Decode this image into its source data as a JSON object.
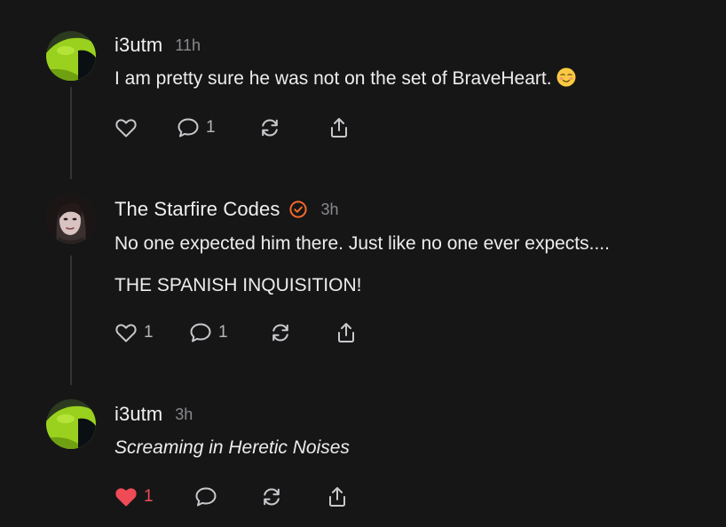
{
  "posts": [
    {
      "username": "i3utm",
      "time": "11h",
      "lines": [
        "I am pretty sure he was not on the set of BraveHeart."
      ],
      "emoji": "relieved-face",
      "likes": "",
      "replies": "1",
      "liked": false
    },
    {
      "username": "The Starfire Codes",
      "time": "3h",
      "verified": true,
      "lines": [
        "No one expected him there. Just like no one ever expects....",
        "THE SPANISH INQUISITION!"
      ],
      "likes": "1",
      "replies": "1",
      "liked": false
    },
    {
      "username": "i3utm",
      "time": "3h",
      "lines": [
        "Screaming in Heretic Noises"
      ],
      "italic": true,
      "likes": "1",
      "replies": "",
      "liked": true
    }
  ],
  "colors": {
    "background": "#161617",
    "text": "#ededed",
    "muted": "#8a8a8e",
    "liked": "#ef4b56",
    "verified": "#f26b2a",
    "thread_line": "#333336"
  }
}
